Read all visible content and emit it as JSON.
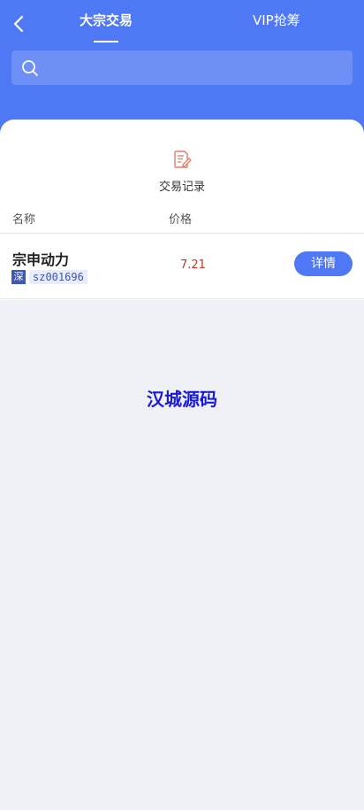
{
  "header": {
    "tabs": [
      {
        "label": "大宗交易",
        "active": true
      },
      {
        "label": "VIP抢筹",
        "active": false
      }
    ],
    "search": {
      "placeholder": ""
    }
  },
  "panel": {
    "record_label": "交易记录",
    "columns": {
      "name": "名称",
      "price": "价格"
    },
    "rows": [
      {
        "name": "宗申动力",
        "market": "深",
        "code": "sz001696",
        "price": "7.21",
        "action_label": "详情"
      }
    ]
  },
  "watermark": "汉城源码",
  "colors": {
    "accent": "#4f78f4",
    "price": "#c0392b",
    "badge": "#3f58b0",
    "watermark": "#1a1ad6"
  },
  "icons": {
    "back": "chevron-left-icon",
    "search": "search-icon",
    "record": "document-edit-icon"
  }
}
